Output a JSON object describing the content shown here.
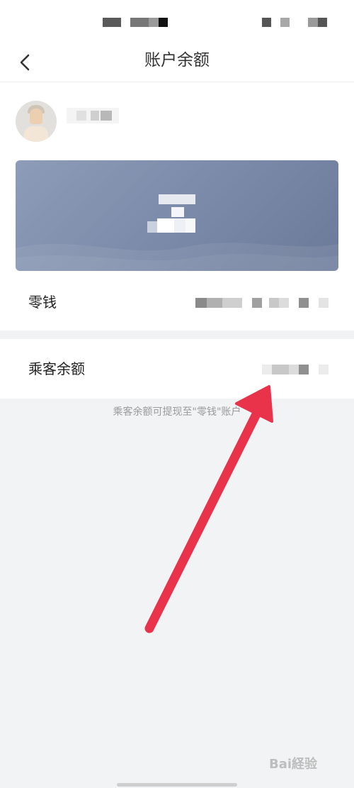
{
  "nav": {
    "title": "账户余额"
  },
  "rows": {
    "wallet_label": "零钱",
    "passenger_balance_label": "乘客余额"
  },
  "hint": {
    "text": "乘客余额可提现至\"零钱\"账户"
  },
  "watermark": {
    "text": "Bai経验"
  },
  "icons": {
    "back": "chevron-left-icon",
    "annotation": "red-arrow-icon"
  },
  "colors": {
    "card_top": "#8d9cb8",
    "card_bottom": "#6b7a99",
    "annotation_arrow": "#e8334a",
    "page_background": "#f2f3f5"
  }
}
